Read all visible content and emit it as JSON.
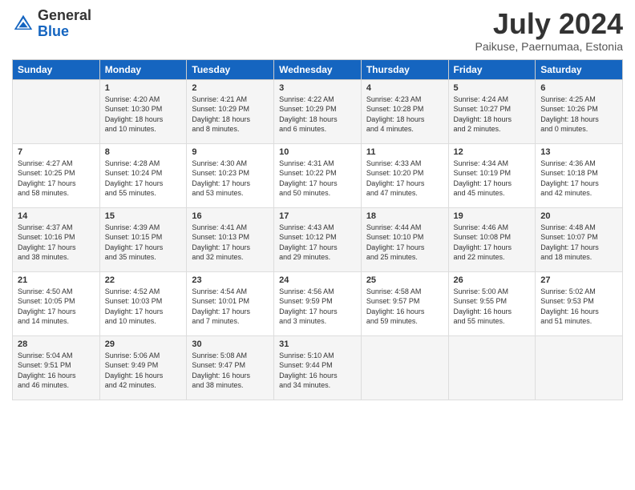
{
  "header": {
    "logo_general": "General",
    "logo_blue": "Blue",
    "month_year": "July 2024",
    "location": "Paikuse, Paernumaa, Estonia"
  },
  "days_of_week": [
    "Sunday",
    "Monday",
    "Tuesday",
    "Wednesday",
    "Thursday",
    "Friday",
    "Saturday"
  ],
  "weeks": [
    [
      {
        "day": "",
        "info": ""
      },
      {
        "day": "1",
        "info": "Sunrise: 4:20 AM\nSunset: 10:30 PM\nDaylight: 18 hours\nand 10 minutes."
      },
      {
        "day": "2",
        "info": "Sunrise: 4:21 AM\nSunset: 10:29 PM\nDaylight: 18 hours\nand 8 minutes."
      },
      {
        "day": "3",
        "info": "Sunrise: 4:22 AM\nSunset: 10:29 PM\nDaylight: 18 hours\nand 6 minutes."
      },
      {
        "day": "4",
        "info": "Sunrise: 4:23 AM\nSunset: 10:28 PM\nDaylight: 18 hours\nand 4 minutes."
      },
      {
        "day": "5",
        "info": "Sunrise: 4:24 AM\nSunset: 10:27 PM\nDaylight: 18 hours\nand 2 minutes."
      },
      {
        "day": "6",
        "info": "Sunrise: 4:25 AM\nSunset: 10:26 PM\nDaylight: 18 hours\nand 0 minutes."
      }
    ],
    [
      {
        "day": "7",
        "info": "Sunrise: 4:27 AM\nSunset: 10:25 PM\nDaylight: 17 hours\nand 58 minutes."
      },
      {
        "day": "8",
        "info": "Sunrise: 4:28 AM\nSunset: 10:24 PM\nDaylight: 17 hours\nand 55 minutes."
      },
      {
        "day": "9",
        "info": "Sunrise: 4:30 AM\nSunset: 10:23 PM\nDaylight: 17 hours\nand 53 minutes."
      },
      {
        "day": "10",
        "info": "Sunrise: 4:31 AM\nSunset: 10:22 PM\nDaylight: 17 hours\nand 50 minutes."
      },
      {
        "day": "11",
        "info": "Sunrise: 4:33 AM\nSunset: 10:20 PM\nDaylight: 17 hours\nand 47 minutes."
      },
      {
        "day": "12",
        "info": "Sunrise: 4:34 AM\nSunset: 10:19 PM\nDaylight: 17 hours\nand 45 minutes."
      },
      {
        "day": "13",
        "info": "Sunrise: 4:36 AM\nSunset: 10:18 PM\nDaylight: 17 hours\nand 42 minutes."
      }
    ],
    [
      {
        "day": "14",
        "info": "Sunrise: 4:37 AM\nSunset: 10:16 PM\nDaylight: 17 hours\nand 38 minutes."
      },
      {
        "day": "15",
        "info": "Sunrise: 4:39 AM\nSunset: 10:15 PM\nDaylight: 17 hours\nand 35 minutes."
      },
      {
        "day": "16",
        "info": "Sunrise: 4:41 AM\nSunset: 10:13 PM\nDaylight: 17 hours\nand 32 minutes."
      },
      {
        "day": "17",
        "info": "Sunrise: 4:43 AM\nSunset: 10:12 PM\nDaylight: 17 hours\nand 29 minutes."
      },
      {
        "day": "18",
        "info": "Sunrise: 4:44 AM\nSunset: 10:10 PM\nDaylight: 17 hours\nand 25 minutes."
      },
      {
        "day": "19",
        "info": "Sunrise: 4:46 AM\nSunset: 10:08 PM\nDaylight: 17 hours\nand 22 minutes."
      },
      {
        "day": "20",
        "info": "Sunrise: 4:48 AM\nSunset: 10:07 PM\nDaylight: 17 hours\nand 18 minutes."
      }
    ],
    [
      {
        "day": "21",
        "info": "Sunrise: 4:50 AM\nSunset: 10:05 PM\nDaylight: 17 hours\nand 14 minutes."
      },
      {
        "day": "22",
        "info": "Sunrise: 4:52 AM\nSunset: 10:03 PM\nDaylight: 17 hours\nand 10 minutes."
      },
      {
        "day": "23",
        "info": "Sunrise: 4:54 AM\nSunset: 10:01 PM\nDaylight: 17 hours\nand 7 minutes."
      },
      {
        "day": "24",
        "info": "Sunrise: 4:56 AM\nSunset: 9:59 PM\nDaylight: 17 hours\nand 3 minutes."
      },
      {
        "day": "25",
        "info": "Sunrise: 4:58 AM\nSunset: 9:57 PM\nDaylight: 16 hours\nand 59 minutes."
      },
      {
        "day": "26",
        "info": "Sunrise: 5:00 AM\nSunset: 9:55 PM\nDaylight: 16 hours\nand 55 minutes."
      },
      {
        "day": "27",
        "info": "Sunrise: 5:02 AM\nSunset: 9:53 PM\nDaylight: 16 hours\nand 51 minutes."
      }
    ],
    [
      {
        "day": "28",
        "info": "Sunrise: 5:04 AM\nSunset: 9:51 PM\nDaylight: 16 hours\nand 46 minutes."
      },
      {
        "day": "29",
        "info": "Sunrise: 5:06 AM\nSunset: 9:49 PM\nDaylight: 16 hours\nand 42 minutes."
      },
      {
        "day": "30",
        "info": "Sunrise: 5:08 AM\nSunset: 9:47 PM\nDaylight: 16 hours\nand 38 minutes."
      },
      {
        "day": "31",
        "info": "Sunrise: 5:10 AM\nSunset: 9:44 PM\nDaylight: 16 hours\nand 34 minutes."
      },
      {
        "day": "",
        "info": ""
      },
      {
        "day": "",
        "info": ""
      },
      {
        "day": "",
        "info": ""
      }
    ]
  ]
}
